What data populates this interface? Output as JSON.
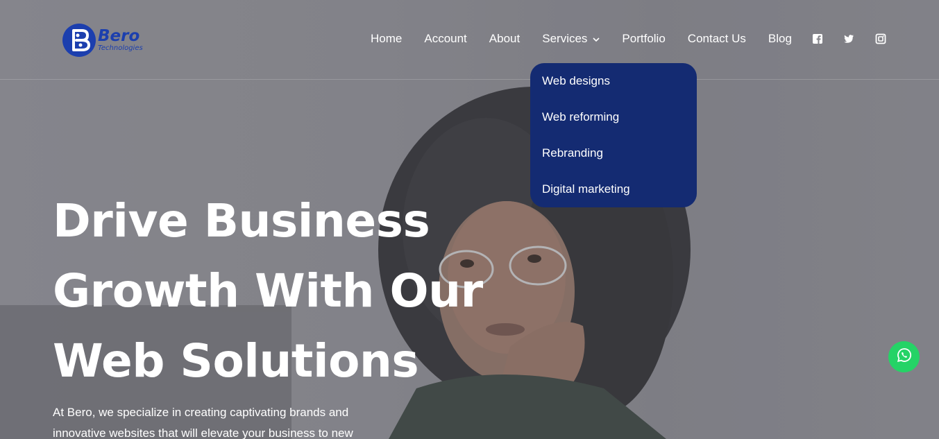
{
  "brand": {
    "name": "Bero",
    "subtitle": "Technologies",
    "color": "#1c3fae"
  },
  "nav": {
    "items": [
      {
        "label": "Home"
      },
      {
        "label": "Account"
      },
      {
        "label": "About"
      },
      {
        "label": "Services",
        "icon": "chevron-down-icon"
      },
      {
        "label": "Portfolio"
      },
      {
        "label": "Contact Us"
      },
      {
        "label": "Blog"
      }
    ],
    "social": [
      {
        "icon": "facebook-icon"
      },
      {
        "icon": "twitter-icon"
      },
      {
        "icon": "instagram-icon"
      }
    ]
  },
  "services_dropdown": {
    "background": "#142b72",
    "items": [
      {
        "label": "Web designs"
      },
      {
        "label": "Web reforming"
      },
      {
        "label": "Rebranding"
      },
      {
        "label": "Digital marketing"
      }
    ]
  },
  "hero": {
    "title_lines": [
      "Drive Business",
      "Growth With Our",
      "Web Solutions"
    ],
    "description": "At Bero, we specialize in creating captivating brands and innovative websites that will elevate your business to new"
  },
  "floating": {
    "whatsapp_icon": "whatsapp-icon",
    "color": "#25d366"
  }
}
